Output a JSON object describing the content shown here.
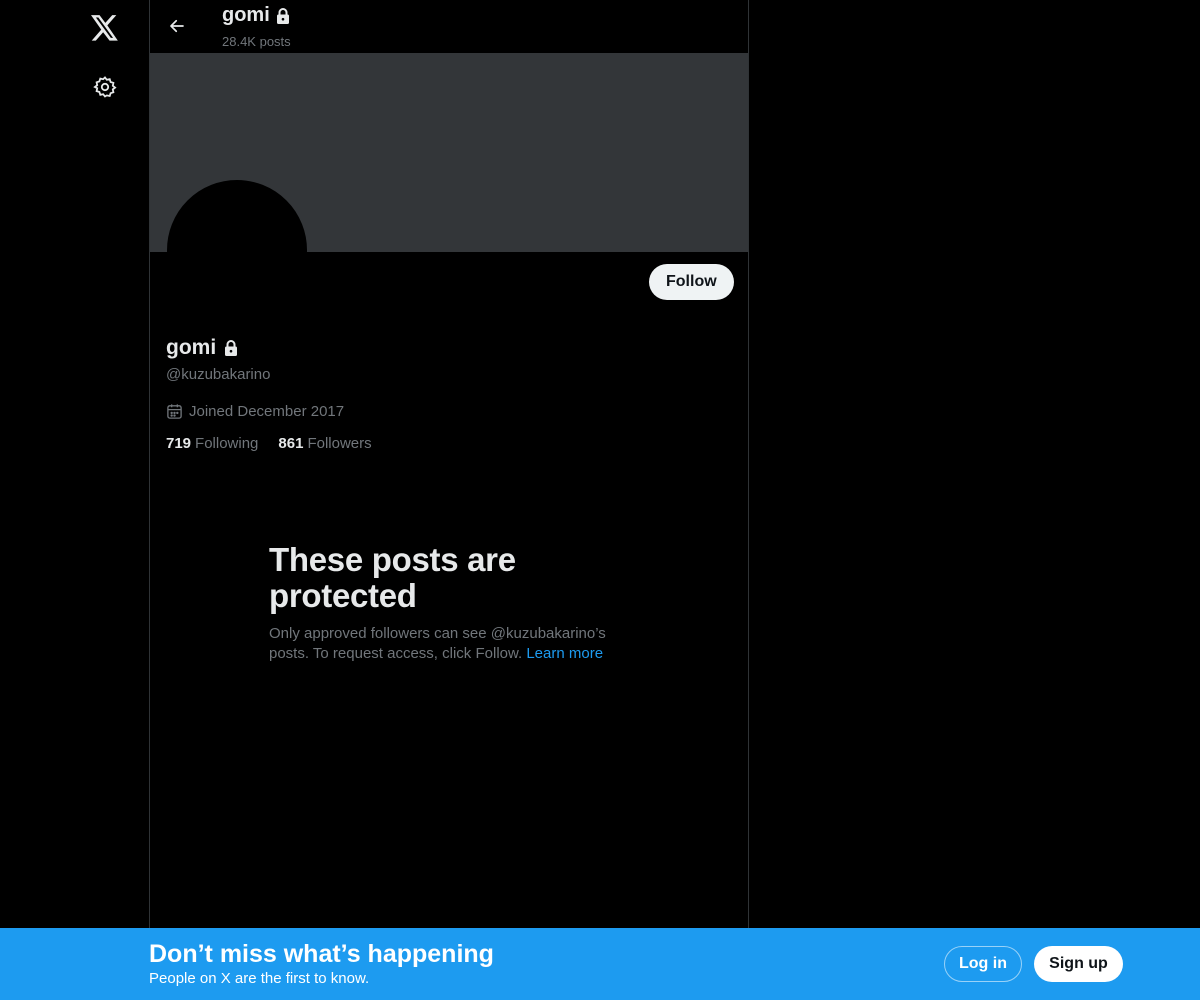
{
  "header": {
    "title": "gomi",
    "post_count": "28.4K posts"
  },
  "profile": {
    "display_name": "gomi",
    "handle": "@kuzubakarino",
    "joined": "Joined December 2017",
    "following_count": "719",
    "following_label": "Following",
    "followers_count": "861",
    "followers_label": "Followers",
    "follow_label": "Follow",
    "protected": true
  },
  "protected_notice": {
    "title": "These posts are protected",
    "body": "Only approved followers can see @kuzubakarino’s posts. To request access, click Follow.",
    "link": "Learn more"
  },
  "bottom_bar": {
    "title": "Don’t miss what’s happening",
    "subtitle": "People on X are the first to know.",
    "login_label": "Log in",
    "signup_label": "Sign up"
  },
  "icons": {
    "logo": "x-logo-icon",
    "settings": "gear-icon",
    "back": "arrow-left-icon",
    "lock": "lock-icon",
    "calendar": "calendar-icon"
  },
  "colors": {
    "accent": "#1d9bf0",
    "background": "#000000",
    "banner": "#333639",
    "text_primary": "#e7e9ea",
    "text_secondary": "#71767b"
  }
}
